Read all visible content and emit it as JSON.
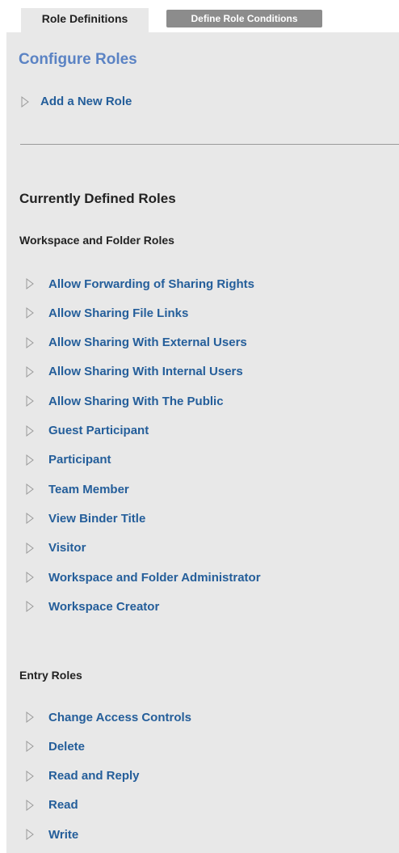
{
  "tabs": {
    "active": "Role Definitions",
    "inactive": "Define Role Conditions"
  },
  "configure": {
    "title": "Configure Roles",
    "add_role": "Add a New Role"
  },
  "current": {
    "title": "Currently Defined Roles",
    "workspace_group": {
      "title": "Workspace and Folder Roles",
      "items": [
        {
          "label": "Allow Forwarding of Sharing Rights"
        },
        {
          "label": "Allow Sharing File Links"
        },
        {
          "label": "Allow Sharing With External Users"
        },
        {
          "label": "Allow Sharing With Internal Users"
        },
        {
          "label": "Allow Sharing With The Public"
        },
        {
          "label": "Guest Participant"
        },
        {
          "label": "Participant"
        },
        {
          "label": "Team Member"
        },
        {
          "label": "View Binder Title"
        },
        {
          "label": "Visitor"
        },
        {
          "label": "Workspace and Folder Administrator"
        },
        {
          "label": "Workspace Creator"
        }
      ]
    },
    "entry_group": {
      "title": "Entry Roles",
      "items": [
        {
          "label": "Change Access Controls"
        },
        {
          "label": "Delete"
        },
        {
          "label": "Read and Reply"
        },
        {
          "label": "Read"
        },
        {
          "label": "Write"
        }
      ]
    }
  },
  "colors": {
    "link": "#245e9a",
    "heading_accent": "#5b83c4",
    "panel_bg": "#e8e8e8",
    "inactive_tab": "#8c8c8c"
  },
  "icons": {
    "expand": "triangle-right-icon"
  }
}
